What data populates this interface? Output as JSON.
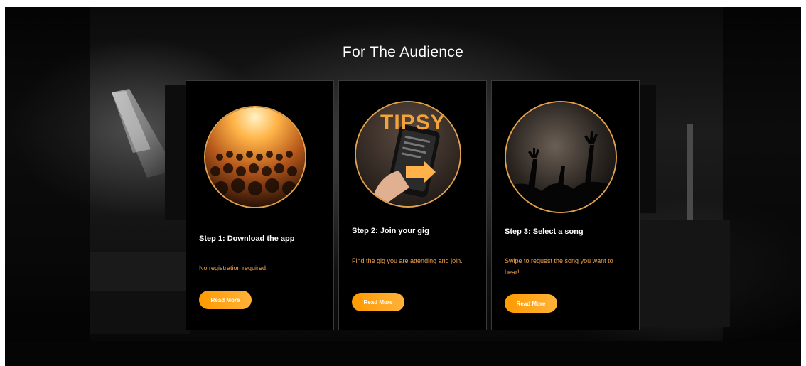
{
  "section": {
    "title": "For The Audience"
  },
  "cards": [
    {
      "step": "Step 1: Download the app",
      "description": "No registration required.",
      "button": "Read More",
      "image_icon": "crowd-photo-icon"
    },
    {
      "step": "Step 2: Join your gig",
      "description": "Find the gig you are attending and join.",
      "button": "Read More",
      "image_icon": "phone-app-photo-icon",
      "logo_text": "TIPSY"
    },
    {
      "step": "Step 3: Select a song",
      "description": "Swipe to request the song you want to hear!",
      "button": "Read More",
      "image_icon": "concert-hands-photo-icon"
    }
  ],
  "colors": {
    "accent": "#ff9a00",
    "description_text": "#f3a24b",
    "card_bg": "#000000"
  }
}
